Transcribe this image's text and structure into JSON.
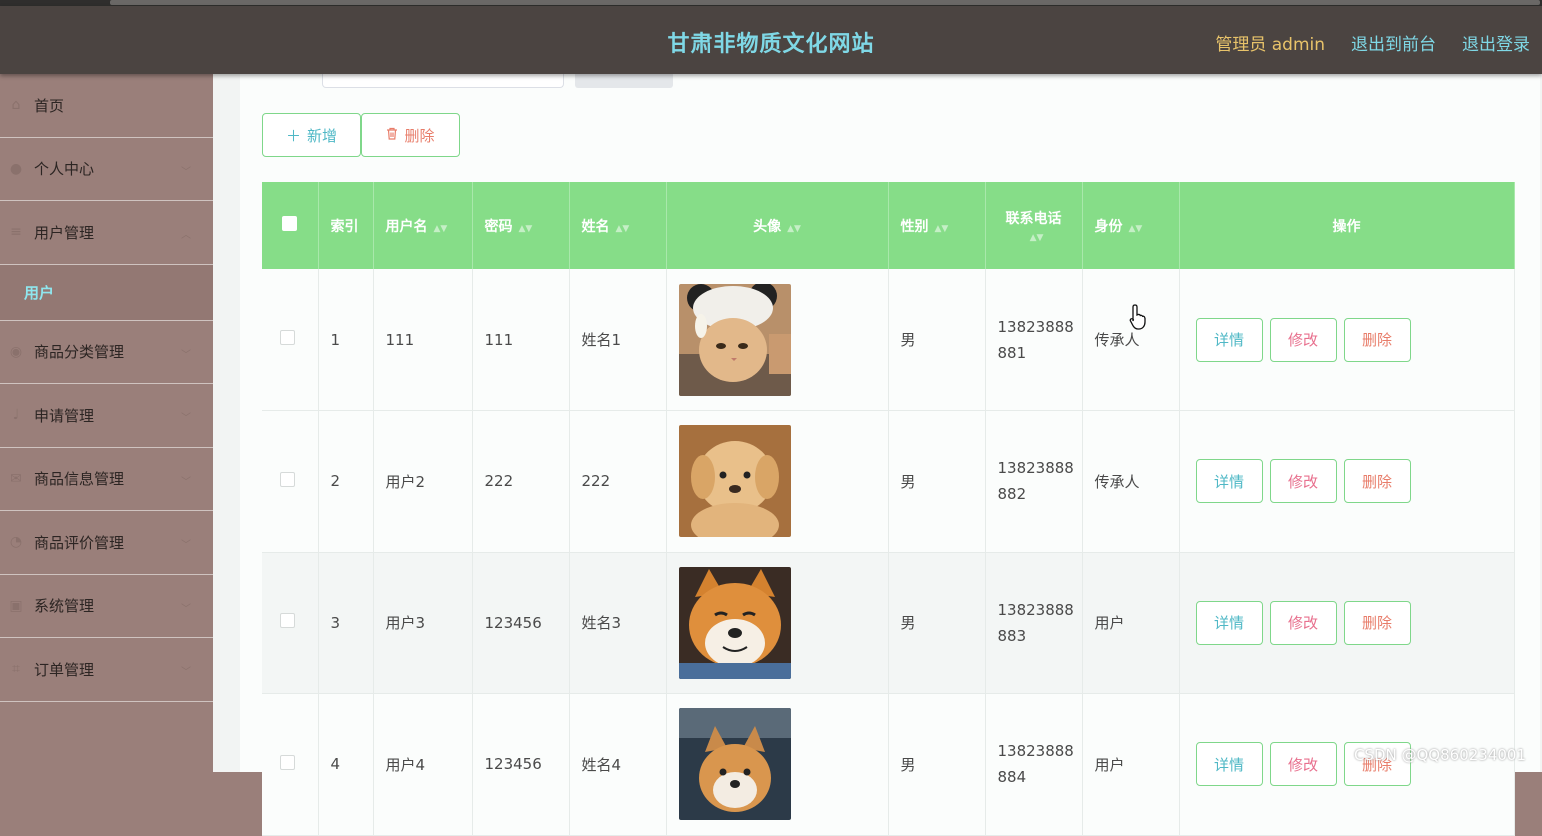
{
  "header": {
    "title": "甘肃非物质文化网站",
    "admin_label": "管理员 admin",
    "back_to_front": "退出到前台",
    "logout": "退出登录"
  },
  "sidebar": {
    "items": [
      {
        "label": "首页",
        "icon": "home-icon"
      },
      {
        "label": "个人中心",
        "icon": "user-icon"
      },
      {
        "label": "用户管理",
        "icon": "list-icon"
      },
      {
        "label": "用户",
        "submenu": true
      },
      {
        "label": "商品分类管理",
        "icon": "location-icon"
      },
      {
        "label": "申请管理",
        "icon": "mic-icon"
      },
      {
        "label": "商品信息管理",
        "icon": "mail-icon"
      },
      {
        "label": "商品评价管理",
        "icon": "clock-icon"
      },
      {
        "label": "系统管理",
        "icon": "briefcase-icon"
      },
      {
        "label": "订单管理",
        "icon": "crop-icon"
      }
    ]
  },
  "toolbar": {
    "add_label": "新增",
    "delete_label": "删除"
  },
  "table": {
    "headers": [
      "索引",
      "用户名",
      "密码",
      "姓名",
      "头像",
      "性别",
      "联系电话",
      "身份",
      "操作"
    ],
    "rows": [
      {
        "index": "1",
        "username": "111",
        "password": "111",
        "name": "姓名1",
        "avatar": "cat-photo",
        "gender": "男",
        "phone_a": "13823888",
        "phone_b": "881",
        "role": "传承人"
      },
      {
        "index": "2",
        "username": "用户2",
        "password": "222",
        "name": "222",
        "avatar": "puppy-photo",
        "gender": "男",
        "phone_a": "13823888",
        "phone_b": "882",
        "role": "传承人"
      },
      {
        "index": "3",
        "username": "用户3",
        "password": "123456",
        "name": "姓名3",
        "avatar": "shiba-photo",
        "gender": "男",
        "phone_a": "13823888",
        "phone_b": "883",
        "role": "用户"
      },
      {
        "index": "4",
        "username": "用户4",
        "password": "123456",
        "name": "姓名4",
        "avatar": "dog-photo",
        "gender": "男",
        "phone_a": "13823888",
        "phone_b": "884",
        "role": "用户"
      }
    ],
    "op_detail": "详情",
    "op_edit": "修改",
    "op_delete": "删除"
  },
  "watermark": "CSDN @QQ860234001"
}
